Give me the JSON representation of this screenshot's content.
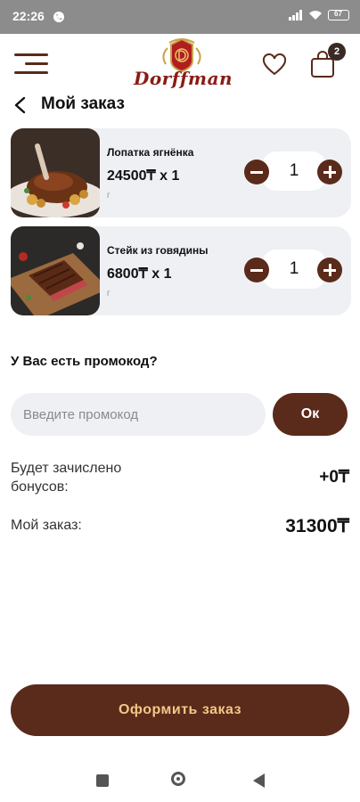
{
  "status_bar": {
    "time": "22:26",
    "battery": "67"
  },
  "header": {
    "brand": "Dorffman",
    "cart_count": "2"
  },
  "page": {
    "title": "Мой заказ"
  },
  "cart_items": [
    {
      "name": "Лопатка ягнёнка",
      "price_line": "24500₸ x 1",
      "unit": "г",
      "quantity": "1",
      "image": "lamb-shoulder-dish"
    },
    {
      "name": "Стейк из говядины",
      "price_line": "6800₸ x 1",
      "unit": "г",
      "quantity": "1",
      "image": "beef-steak-board"
    }
  ],
  "promo": {
    "question": "У Вас есть промокод?",
    "placeholder": "Введите промокод",
    "button_label": "Ок"
  },
  "summary": {
    "bonus_label": "Будет зачислено бонусов:",
    "bonus_value": "+0₸",
    "order_label": "Мой заказ:",
    "order_value": "31300₸"
  },
  "checkout": {
    "label": "Оформить заказ"
  },
  "colors": {
    "accent": "#5a2a1a",
    "checkout_text": "#f3c788",
    "card_bg": "#eff0f4",
    "status_bar": "#8c8c8c"
  },
  "icons": [
    "menu-icon",
    "heart-icon",
    "cart-icon",
    "back-arrow-icon",
    "minus-icon",
    "plus-icon",
    "nav-recents-icon",
    "nav-home-icon",
    "nav-back-icon"
  ]
}
